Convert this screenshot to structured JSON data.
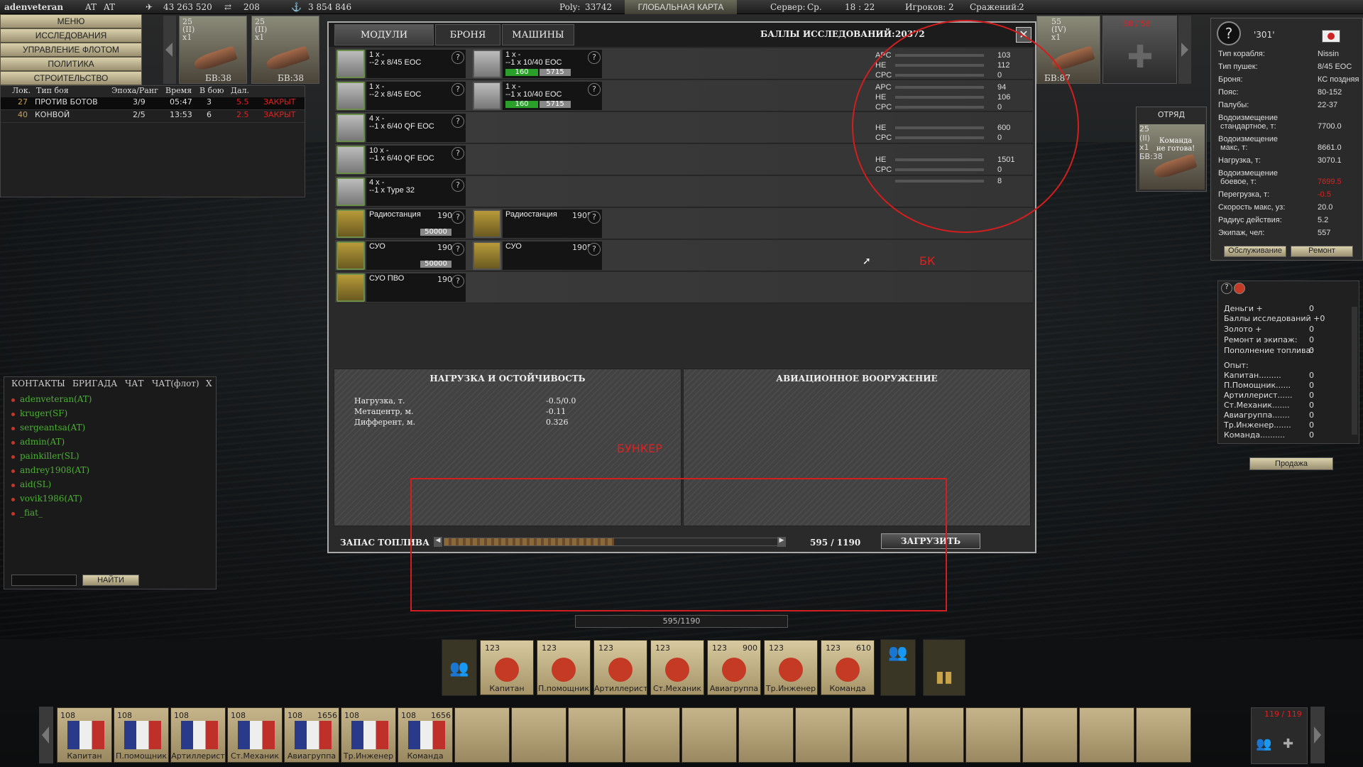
{
  "topbar": {
    "username": "adenveteran",
    "at1": "AT",
    "at2": "AT",
    "credits": "43 263 520",
    "planes": "208",
    "xp": "3 854 846",
    "poly_label": "Poly:",
    "poly_value": "33742",
    "global_map": "ГЛОБАЛЬНАЯ КАРТА",
    "server_label": "Сервер:",
    "server_value": "Ср.",
    "time": "18 : 22",
    "players_label": "Игроков:",
    "players_value": "2",
    "battles_label": "Сражений:",
    "battles_value": "2"
  },
  "menu": [
    "МЕНЮ",
    "ИССЛЕДОВАНИЯ",
    "УПРАВЛЕНИЕ ФЛОТОМ",
    "ПОЛИТИКА",
    "СТРОИТЕЛЬСТВО"
  ],
  "battles": {
    "headers": [
      "Лок.",
      "Тип боя",
      "Эпоха/Ранг",
      "Время",
      "В бою",
      "Дал."
    ],
    "rows": [
      [
        "27",
        "ПРОТИВ БОТОВ",
        "3/9",
        "05:47",
        "3",
        "5.5",
        "ЗАКРЫТ"
      ],
      [
        "40",
        "КОНВОЙ",
        "2/5",
        "13:53",
        "6",
        "2.5",
        "ЗАКРЫТ"
      ]
    ]
  },
  "ships": [
    {
      "tier": "25\n(II)\nx1",
      "bv": "БВ:38"
    },
    {
      "tier": "25\n(II)\nx1",
      "bv": "БВ:38"
    }
  ],
  "ships_right": {
    "tier": "55\n(IV)\nx1",
    "bv": "БВ:87",
    "counter": "58 / 58"
  },
  "dialog": {
    "tabs": [
      "МОДУЛИ",
      "БРОНЯ",
      "МАШИНЫ"
    ],
    "research_label": "БАЛЛЫ ИССЛЕДОВАНИЙ:",
    "research_value": "20372",
    "modules": [
      {
        "text": "1 x -\n--2 x 8/45 EOC",
        "right": {
          "text": "1 x -\n--1 x 10/40 EOC",
          "g": "160",
          "w": "5715"
        }
      },
      {
        "text": "1 x -\n--2 x 8/45 EOC",
        "right": {
          "text": "1 x -\n--1 x 10/40 EOC",
          "g": "160",
          "w": "5715"
        }
      },
      {
        "text": "4 x -\n--1 x 6/40 QF EOC"
      },
      {
        "text": "10 x -\n--1 x 6/40 QF EOC"
      },
      {
        "text": "4 x -\n--1 x Type 32"
      }
    ],
    "radio": [
      {
        "name": "Радиостанция",
        "year": "1900",
        "price": "50000"
      },
      {
        "name": "Радиостанция",
        "year": "1905"
      }
    ],
    "fcs": [
      {
        "name": "СУО",
        "year": "1900",
        "price": "50000"
      },
      {
        "name": "СУО",
        "year": "1905"
      }
    ],
    "aa": {
      "name": "СУО ПВО",
      "year": "1900"
    },
    "ammo": [
      [
        {
          "l": "APC",
          "v": "103"
        },
        {
          "l": "HE",
          "v": "112"
        },
        {
          "l": "CPC",
          "v": "0"
        }
      ],
      [
        {
          "l": "APC",
          "v": "94"
        },
        {
          "l": "HE",
          "v": "106"
        },
        {
          "l": "CPC",
          "v": "0"
        }
      ],
      [
        {
          "l": "HE",
          "v": "600"
        },
        {
          "l": "CPC",
          "v": "0"
        }
      ],
      [
        {
          "l": "HE",
          "v": "1501"
        },
        {
          "l": "CPC",
          "v": "0"
        }
      ],
      [
        {
          "l": "",
          "v": "8"
        }
      ]
    ],
    "bk_label": "БК",
    "bunker_label": "БУНКЕР",
    "load_title": "НАГРУЗКА И ОСТОЙЧИВОСТЬ",
    "load": [
      {
        "l": "Нагрузка, т.",
        "v": "-0.5/0.0"
      },
      {
        "l": "Метацентр, м.",
        "v": "-0.11"
      },
      {
        "l": "Дифферент, м.",
        "v": "0.326"
      }
    ],
    "air_title": "АВИАЦИОННОЕ ВООРУЖЕНИЕ",
    "fuel_label": "ЗАПАС ТОПЛИВА",
    "fuel_value": "595 / 1190",
    "fuel_fraction": 0.5,
    "load_btn": "ЗАГРУЗИТЬ"
  },
  "fuelbar": "595/1190",
  "shipinfo": {
    "name": "'301'",
    "rows": [
      [
        "Тип корабля:",
        "Nissin"
      ],
      [
        "Тип пушек:",
        "8/45 EOC"
      ],
      [
        "Броня:",
        "КС поздняя"
      ],
      [
        "Пояс:",
        "80-152"
      ],
      [
        "Палубы:",
        "22-37"
      ],
      [
        "Водоизмещение\n стандартное, т:",
        "7700.0"
      ],
      [
        "Водоизмещение\n макс, т:",
        "8661.0"
      ],
      [
        "Нагрузка, т:",
        "3070.1"
      ],
      [
        "Водоизмещение\n боевое, т:",
        "7699.5"
      ],
      [
        "Перегрузка, т:",
        "-0.5"
      ],
      [
        "Скорость макс, уз:",
        "20.0"
      ],
      [
        "Радиус действия:",
        "5.2"
      ],
      [
        "Экипаж, чел:",
        "557"
      ]
    ],
    "btn_service": "Обслуживание",
    "btn_repair": "Ремонт"
  },
  "squad": {
    "title": "ОТРЯД",
    "tier": "25\n(II)\nx1",
    "bv": "БВ:38",
    "note": "Команда\nне готова!"
  },
  "income": {
    "rows": [
      [
        "Деньги +",
        "0"
      ],
      [
        "Баллы исследований +0",
        ""
      ],
      [
        "Золото +",
        "0"
      ],
      [
        "Ремонт и экипаж:",
        "0"
      ],
      [
        "Пополнение топлива:",
        "0"
      ],
      [
        "Опыт:",
        ""
      ],
      [
        "Капитан.........",
        "0"
      ],
      [
        "П.Помощник......",
        "0"
      ],
      [
        "Артиллерист......",
        "0"
      ],
      [
        "Ст.Механик.......",
        "0"
      ],
      [
        "Авиагруппа.......",
        "0"
      ],
      [
        "Тр.Инженер.......",
        "0"
      ],
      [
        "Команда..........",
        "0"
      ]
    ],
    "sell": "Продажа"
  },
  "contacts": {
    "tabs": [
      "КОНТАКТЫ",
      "БРИГАДА",
      "ЧАТ",
      "ЧАТ(флот)",
      "X"
    ],
    "list": [
      "adenveteran(AT)",
      "kruger(SF)",
      "sergeantsa(AT)",
      "admin(AT)",
      "painkiller(SL)",
      "andrey1908(AT)",
      "aid(SL)",
      "vovik1986(AT)",
      "_fiat_"
    ],
    "find": "НАЙТИ"
  },
  "crew": [
    {
      "n": "123",
      "l": "Капитан"
    },
    {
      "n": "123",
      "l": "П.помощник"
    },
    {
      "n": "123",
      "l": "Артиллерист"
    },
    {
      "n": "123",
      "l": "Ст.Механик"
    },
    {
      "n": "123",
      "l": "Авиагруппа",
      "x": "900"
    },
    {
      "n": "123",
      "l": "Тр.Инженер"
    },
    {
      "n": "123",
      "l": "Команда",
      "x": "610"
    }
  ],
  "reserve": [
    {
      "n": "108",
      "l": "Капитан"
    },
    {
      "n": "108",
      "l": "П.помощник"
    },
    {
      "n": "108",
      "l": "Артиллерист"
    },
    {
      "n": "108",
      "l": "Ст.Механик"
    },
    {
      "n": "108",
      "l": "Авиагруппа",
      "x": "1656"
    },
    {
      "n": "108",
      "l": "Тр.Инженер"
    },
    {
      "n": "108",
      "l": "Команда",
      "x": "1656"
    }
  ],
  "reserve_counter": "119 / 119"
}
